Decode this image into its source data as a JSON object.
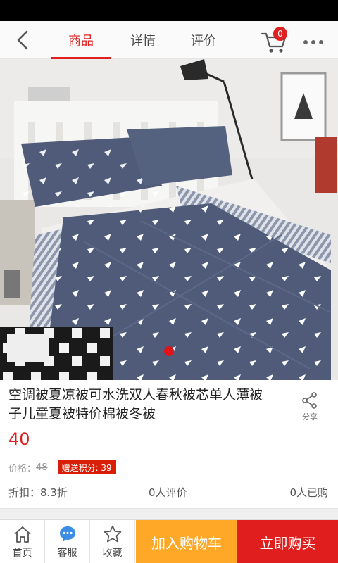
{
  "nav": {
    "tabs": [
      {
        "label": "商品",
        "active": true
      },
      {
        "label": "详情",
        "active": false
      },
      {
        "label": "评价",
        "active": false
      }
    ],
    "cart_count": "0"
  },
  "product": {
    "title": "空调被夏凉被可水洗双人春秋被芯单人薄被子儿童夏被特价棉被冬被",
    "share_label": "分享",
    "price": "40",
    "original_price_label": "价格：",
    "original_price": "48",
    "points_badge": "赠送积分: 39",
    "discount": "折扣：8.3折",
    "reviews": "0人评价",
    "sold": "0人已购"
  },
  "bottom_bar": {
    "home_label": "首页",
    "service_label": "客服",
    "favorite_label": "收藏",
    "add_cart_label": "加入购物车",
    "buy_now_label": "立即购买"
  },
  "colors": {
    "accent": "#e02020",
    "add_cart_bg": "#ffa726",
    "buy_now_bg": "#e01e1e",
    "comforter": "#4f5b78"
  },
  "icons": [
    "back-arrow-icon",
    "cart-icon",
    "more-dots-icon",
    "share-icon",
    "home-icon",
    "chat-icon",
    "star-icon"
  ]
}
